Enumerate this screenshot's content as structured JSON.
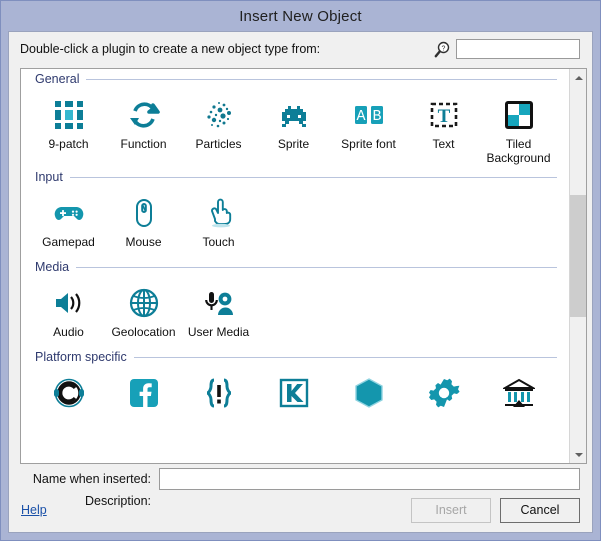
{
  "window": {
    "title": "Insert New Object"
  },
  "prompt": {
    "label": "Double-click a plugin to create a new object type from:",
    "search_icon": "magnifier-help-icon",
    "search_value": "",
    "search_placeholder": ""
  },
  "categories": [
    {
      "name": "General",
      "items": [
        {
          "label": "9-patch",
          "icon": "nine-patch-icon"
        },
        {
          "label": "Function",
          "icon": "function-arrows-icon"
        },
        {
          "label": "Particles",
          "icon": "particles-dots-icon"
        },
        {
          "label": "Sprite",
          "icon": "sprite-invader-icon"
        },
        {
          "label": "Sprite font",
          "icon": "sprite-font-ab-icon"
        },
        {
          "label": "Text",
          "icon": "text-t-icon"
        },
        {
          "label": "Tiled Background",
          "icon": "tiled-background-checker-icon"
        }
      ]
    },
    {
      "name": "Input",
      "items": [
        {
          "label": "Gamepad",
          "icon": "gamepad-icon"
        },
        {
          "label": "Mouse",
          "icon": "mouse-icon"
        },
        {
          "label": "Touch",
          "icon": "touch-hand-icon"
        }
      ]
    },
    {
      "name": "Media",
      "items": [
        {
          "label": "Audio",
          "icon": "speaker-icon"
        },
        {
          "label": "Geolocation",
          "icon": "globe-icon"
        },
        {
          "label": "User Media",
          "icon": "microphone-webcam-icon"
        }
      ]
    },
    {
      "name": "Platform specific",
      "items": [
        {
          "label": "",
          "icon": "construct-c-icon"
        },
        {
          "label": "",
          "icon": "facebook-icon"
        },
        {
          "label": "",
          "icon": "braces-exclamation-icon"
        },
        {
          "label": "",
          "icon": "kongregate-k-icon"
        },
        {
          "label": "",
          "icon": "compass-hexagon-icon"
        },
        {
          "label": "",
          "icon": "gear-icon"
        },
        {
          "label": "",
          "icon": "bank-building-icon"
        }
      ]
    }
  ],
  "scrollbar": {
    "up_icon": "chevron-up-icon",
    "down_icon": "chevron-down-icon"
  },
  "form": {
    "name_label": "Name when inserted:",
    "name_value": "",
    "name_placeholder": "",
    "description_label": "Description:",
    "description_value": ""
  },
  "footer": {
    "help_label": "Help",
    "insert_label": "Insert",
    "cancel_label": "Cancel"
  },
  "colors": {
    "title_bar": "#aab4d4",
    "accent_teal": "#1195ac",
    "accent_teal_dark": "#0b6f84",
    "category_text": "#2f3a6e",
    "link": "#1a50a8"
  }
}
